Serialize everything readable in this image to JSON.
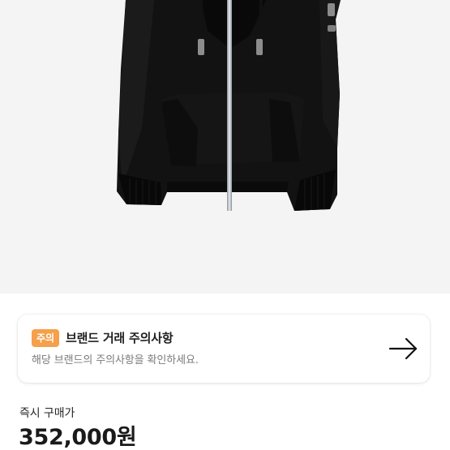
{
  "notice": {
    "badge": "주의",
    "title": "브랜드 거래 주의사항",
    "description": "해당 브랜드의 주의사항을 확인하세요.",
    "arrow_icon": "arrow-right-icon",
    "badge_color": "#f5a04a"
  },
  "purchase": {
    "label": "즉시 구매가",
    "price": "352,000원"
  },
  "product": {
    "image_background": "#f4f4f4",
    "garment_color": "#121212"
  }
}
